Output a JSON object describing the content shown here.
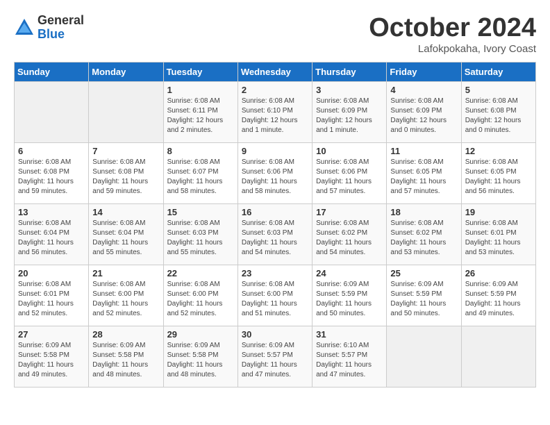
{
  "logo": {
    "general": "General",
    "blue": "Blue"
  },
  "title": "October 2024",
  "location": "Lafokpokaha, Ivory Coast",
  "days_of_week": [
    "Sunday",
    "Monday",
    "Tuesday",
    "Wednesday",
    "Thursday",
    "Friday",
    "Saturday"
  ],
  "weeks": [
    [
      {
        "day": "",
        "content": ""
      },
      {
        "day": "",
        "content": ""
      },
      {
        "day": "1",
        "content": "Sunrise: 6:08 AM\nSunset: 6:11 PM\nDaylight: 12 hours\nand 2 minutes."
      },
      {
        "day": "2",
        "content": "Sunrise: 6:08 AM\nSunset: 6:10 PM\nDaylight: 12 hours\nand 1 minute."
      },
      {
        "day": "3",
        "content": "Sunrise: 6:08 AM\nSunset: 6:09 PM\nDaylight: 12 hours\nand 1 minute."
      },
      {
        "day": "4",
        "content": "Sunrise: 6:08 AM\nSunset: 6:09 PM\nDaylight: 12 hours\nand 0 minutes."
      },
      {
        "day": "5",
        "content": "Sunrise: 6:08 AM\nSunset: 6:08 PM\nDaylight: 12 hours\nand 0 minutes."
      }
    ],
    [
      {
        "day": "6",
        "content": "Sunrise: 6:08 AM\nSunset: 6:08 PM\nDaylight: 11 hours\nand 59 minutes."
      },
      {
        "day": "7",
        "content": "Sunrise: 6:08 AM\nSunset: 6:08 PM\nDaylight: 11 hours\nand 59 minutes."
      },
      {
        "day": "8",
        "content": "Sunrise: 6:08 AM\nSunset: 6:07 PM\nDaylight: 11 hours\nand 58 minutes."
      },
      {
        "day": "9",
        "content": "Sunrise: 6:08 AM\nSunset: 6:06 PM\nDaylight: 11 hours\nand 58 minutes."
      },
      {
        "day": "10",
        "content": "Sunrise: 6:08 AM\nSunset: 6:06 PM\nDaylight: 11 hours\nand 57 minutes."
      },
      {
        "day": "11",
        "content": "Sunrise: 6:08 AM\nSunset: 6:05 PM\nDaylight: 11 hours\nand 57 minutes."
      },
      {
        "day": "12",
        "content": "Sunrise: 6:08 AM\nSunset: 6:05 PM\nDaylight: 11 hours\nand 56 minutes."
      }
    ],
    [
      {
        "day": "13",
        "content": "Sunrise: 6:08 AM\nSunset: 6:04 PM\nDaylight: 11 hours\nand 56 minutes."
      },
      {
        "day": "14",
        "content": "Sunrise: 6:08 AM\nSunset: 6:04 PM\nDaylight: 11 hours\nand 55 minutes."
      },
      {
        "day": "15",
        "content": "Sunrise: 6:08 AM\nSunset: 6:03 PM\nDaylight: 11 hours\nand 55 minutes."
      },
      {
        "day": "16",
        "content": "Sunrise: 6:08 AM\nSunset: 6:03 PM\nDaylight: 11 hours\nand 54 minutes."
      },
      {
        "day": "17",
        "content": "Sunrise: 6:08 AM\nSunset: 6:02 PM\nDaylight: 11 hours\nand 54 minutes."
      },
      {
        "day": "18",
        "content": "Sunrise: 6:08 AM\nSunset: 6:02 PM\nDaylight: 11 hours\nand 53 minutes."
      },
      {
        "day": "19",
        "content": "Sunrise: 6:08 AM\nSunset: 6:01 PM\nDaylight: 11 hours\nand 53 minutes."
      }
    ],
    [
      {
        "day": "20",
        "content": "Sunrise: 6:08 AM\nSunset: 6:01 PM\nDaylight: 11 hours\nand 52 minutes."
      },
      {
        "day": "21",
        "content": "Sunrise: 6:08 AM\nSunset: 6:00 PM\nDaylight: 11 hours\nand 52 minutes."
      },
      {
        "day": "22",
        "content": "Sunrise: 6:08 AM\nSunset: 6:00 PM\nDaylight: 11 hours\nand 52 minutes."
      },
      {
        "day": "23",
        "content": "Sunrise: 6:08 AM\nSunset: 6:00 PM\nDaylight: 11 hours\nand 51 minutes."
      },
      {
        "day": "24",
        "content": "Sunrise: 6:09 AM\nSunset: 5:59 PM\nDaylight: 11 hours\nand 50 minutes."
      },
      {
        "day": "25",
        "content": "Sunrise: 6:09 AM\nSunset: 5:59 PM\nDaylight: 11 hours\nand 50 minutes."
      },
      {
        "day": "26",
        "content": "Sunrise: 6:09 AM\nSunset: 5:59 PM\nDaylight: 11 hours\nand 49 minutes."
      }
    ],
    [
      {
        "day": "27",
        "content": "Sunrise: 6:09 AM\nSunset: 5:58 PM\nDaylight: 11 hours\nand 49 minutes."
      },
      {
        "day": "28",
        "content": "Sunrise: 6:09 AM\nSunset: 5:58 PM\nDaylight: 11 hours\nand 48 minutes."
      },
      {
        "day": "29",
        "content": "Sunrise: 6:09 AM\nSunset: 5:58 PM\nDaylight: 11 hours\nand 48 minutes."
      },
      {
        "day": "30",
        "content": "Sunrise: 6:09 AM\nSunset: 5:57 PM\nDaylight: 11 hours\nand 47 minutes."
      },
      {
        "day": "31",
        "content": "Sunrise: 6:10 AM\nSunset: 5:57 PM\nDaylight: 11 hours\nand 47 minutes."
      },
      {
        "day": "",
        "content": ""
      },
      {
        "day": "",
        "content": ""
      }
    ]
  ]
}
